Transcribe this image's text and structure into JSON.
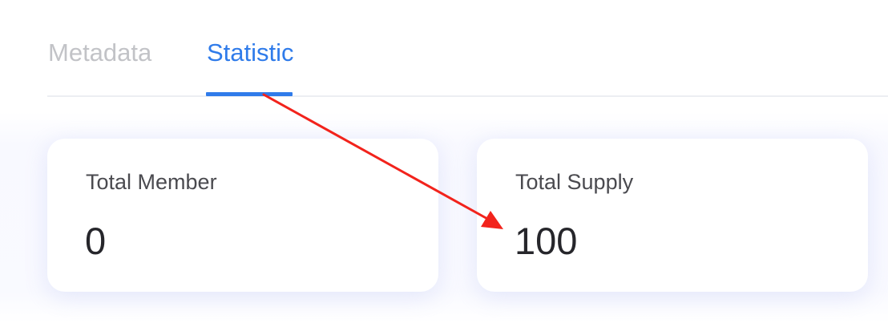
{
  "tabs": {
    "items": [
      {
        "label": "Metadata",
        "active": false
      },
      {
        "label": "Statistic",
        "active": true
      }
    ]
  },
  "stats": [
    {
      "label": "Total Member",
      "value": "0"
    },
    {
      "label": "Total Supply",
      "value": "100"
    }
  ],
  "colors": {
    "accent": "#2f7bea",
    "inactive_tab": "#c2c3c7",
    "annotation_arrow": "#f2231c"
  }
}
